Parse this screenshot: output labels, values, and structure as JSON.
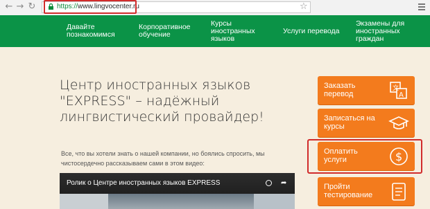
{
  "browser": {
    "url_protocol": "https://",
    "url_host": "www.lingvocenter.ru"
  },
  "nav": {
    "items": [
      {
        "line1": "Давайте",
        "line2": "познакомимся",
        "line3": ""
      },
      {
        "line1": "Корпоративное",
        "line2": "обучение",
        "line3": ""
      },
      {
        "line1": "Курсы",
        "line2": "иностранных",
        "line3": "языков"
      },
      {
        "line1": "Услуги перевода",
        "line2": "",
        "line3": ""
      },
      {
        "line1": "Экзамены для",
        "line2": "иностранных",
        "line3": "граждан"
      }
    ]
  },
  "main": {
    "headline_l1": "Центр иностранных языков",
    "headline_l2": "\"EXPRESS\" – надёжный",
    "headline_l3": "лингвистический провайдер!",
    "intro_l1": "Все, что вы хотели знать о нашей компании, но боялись спросить, мы",
    "intro_l2": "чистосердечно рассказываем сами в этом видео:",
    "video_title": "Ролик о Центре иностранных языков EXPRESS"
  },
  "sidebar": {
    "buttons": [
      {
        "line1": "Заказать",
        "line2": "перевод",
        "icon": "translate-icon"
      },
      {
        "line1": "Записаться на",
        "line2": "курсы",
        "icon": "graduation-cap-icon"
      },
      {
        "line1": "Оплатить",
        "line2": "услуги",
        "icon": "dollar-icon"
      },
      {
        "line1": "Пройти",
        "line2": "тестирование",
        "icon": "checklist-icon"
      }
    ]
  },
  "colors": {
    "nav_green": "#0b9347",
    "button_orange": "#f37b1d",
    "highlight_red": "#d12b2b",
    "page_bg": "#f6eedf"
  }
}
